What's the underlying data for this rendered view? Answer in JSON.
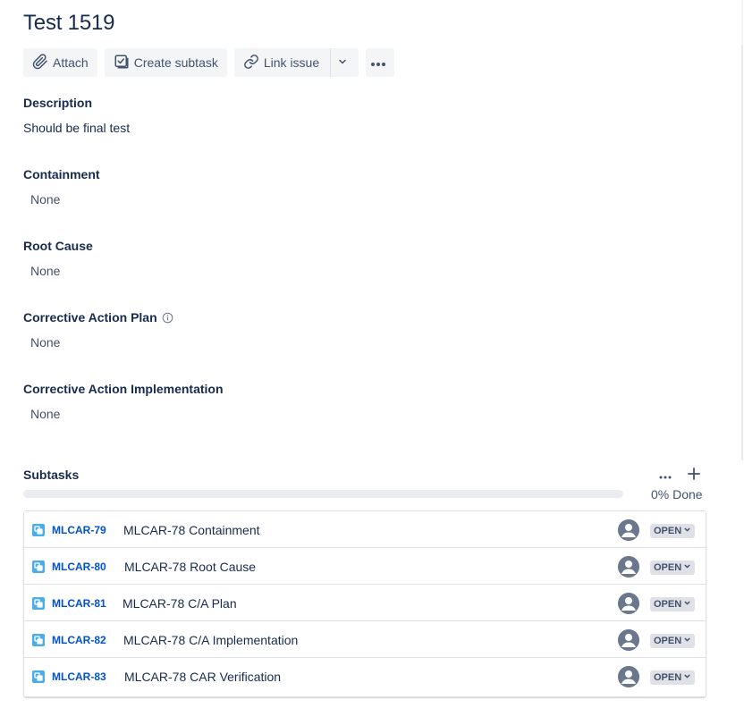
{
  "issue": {
    "title": "Test 1519"
  },
  "toolbar": {
    "attach_label": "Attach",
    "create_subtask_label": "Create subtask",
    "link_issue_label": "Link issue",
    "icons": [
      "paperclip-icon",
      "subtask-icon",
      "link-icon",
      "chevron-down-icon",
      "more-icon"
    ]
  },
  "fields": {
    "description": {
      "label": "Description",
      "value": "Should be final test"
    },
    "containment": {
      "label": "Containment",
      "value": "None"
    },
    "root_cause": {
      "label": "Root Cause",
      "value": "None"
    },
    "corrective_action_plan": {
      "label": "Corrective Action Plan",
      "value": "None"
    },
    "corrective_action_implementation": {
      "label": "Corrective Action Implementation",
      "value": "None"
    }
  },
  "subtasks": {
    "title": "Subtasks",
    "progress_percent": 0,
    "progress_text": "0% Done",
    "items": [
      {
        "key": "MLCAR-79",
        "summary": "MLCAR-78 Containment",
        "status": "OPEN"
      },
      {
        "key": "MLCAR-80",
        "summary": "MLCAR-78 Root Cause",
        "status": "OPEN"
      },
      {
        "key": "MLCAR-81",
        "summary": "MLCAR-78 C/A Plan",
        "status": "OPEN"
      },
      {
        "key": "MLCAR-82",
        "summary": "MLCAR-78 C/A Implementation",
        "status": "OPEN"
      },
      {
        "key": "MLCAR-83",
        "summary": "MLCAR-78 CAR Verification",
        "status": "OPEN"
      }
    ]
  },
  "colors": {
    "text": "#172B4D",
    "subtle_text": "#42526E",
    "link": "#0052CC",
    "button_bg": "#F4F5F7",
    "lozenge_bg": "#DFE1E6",
    "subtask_icon": "#4BADE8"
  }
}
